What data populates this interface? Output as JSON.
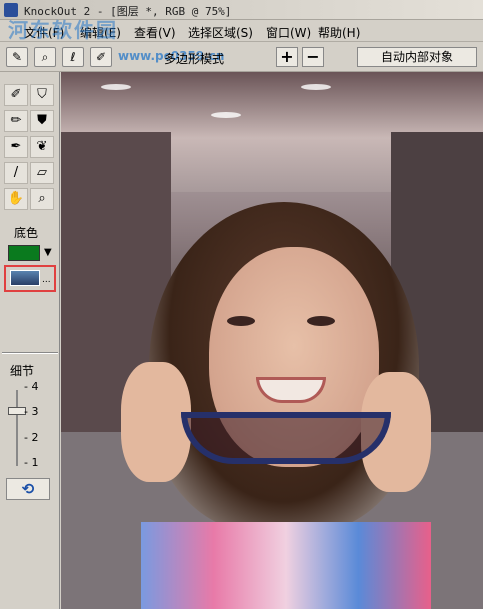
{
  "window": {
    "title": "KnockOut 2 - [图层 *, RGB @ 75%]"
  },
  "menu": {
    "items": [
      {
        "label": "文件(F)"
      },
      {
        "label": "编辑(E)"
      },
      {
        "label": "查看(V)"
      },
      {
        "label": "选择区域(S)"
      },
      {
        "label": "窗口(W)"
      },
      {
        "label": "帮助(H)"
      }
    ],
    "watermark": "河东软件园"
  },
  "toolbar": {
    "watermark_url": "www.pc0359.cn",
    "mode_label": "多边形模式",
    "plus_label": "+",
    "minus_label": "−",
    "auto_label": "自动内部对象"
  },
  "left_panel": {
    "color_label": "底色",
    "color_value": "#0a7a1e",
    "thumb_dots": "...",
    "detail_label": "细节",
    "slider_ticks": [
      "- 4",
      "- 3",
      "- 2",
      "- 1"
    ],
    "slider_value": 3,
    "refresh_icon": "⟲"
  }
}
